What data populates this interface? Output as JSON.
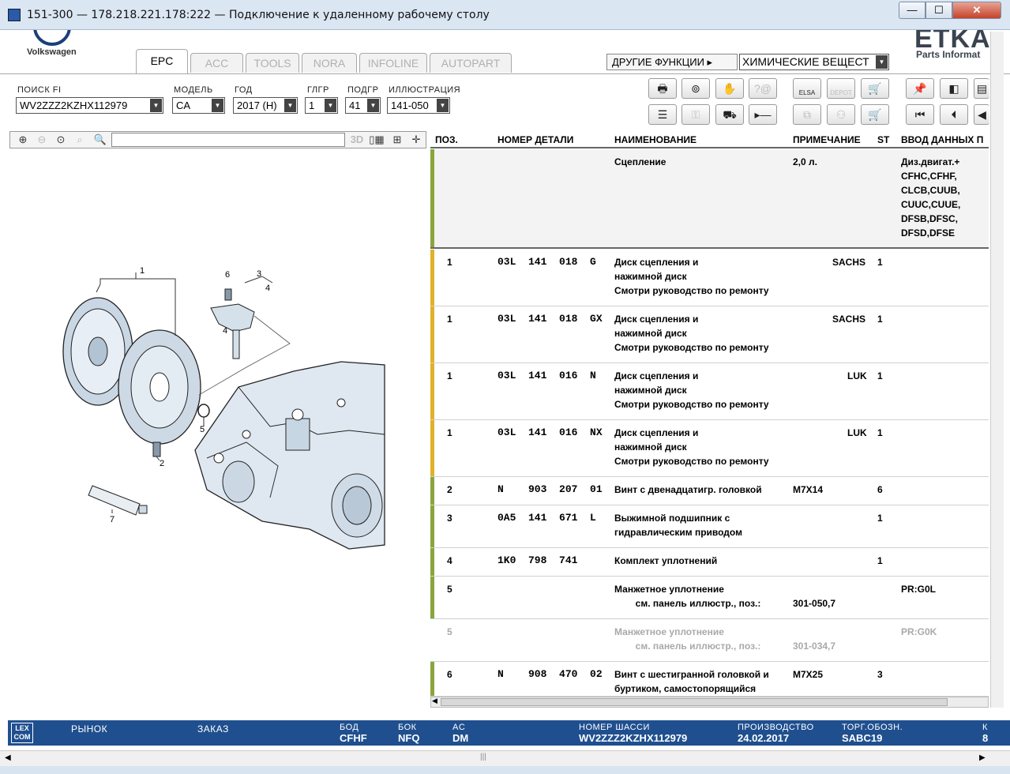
{
  "window": {
    "title": "151-300 — 178.218.221.178:222 — Подключение к удаленному рабочему столу",
    "min_label": "—",
    "max_label": "☐",
    "close_label": "✕"
  },
  "header": {
    "brand": "Volkswagen",
    "etka": "ETKA",
    "etka_sub": "Parts Informat",
    "tabs": [
      "EPC",
      "ACC",
      "TOOLS",
      "NORA",
      "INFOLINE",
      "AUTOPART"
    ],
    "other_functions": "ДРУГИЕ ФУНКЦИИ ▸",
    "chemicals": "ХИМИЧЕСКИЕ ВЕЩЕСТ"
  },
  "filters": {
    "search_label": "ПОИСК FI",
    "search_value": "WV2ZZZ2KZHX112979",
    "model_label": "МОДЕЛЬ",
    "model_value": "CA",
    "year_label": "ГОД",
    "year_value": "2017 (H)",
    "glgr_label": "ГЛГР",
    "glgr_value": "1",
    "podgr_label": "ПОДГР",
    "podgr_value": "41",
    "illus_label": "ИЛЛЮСТРАЦИЯ",
    "illus_value": "141-050"
  },
  "toolbar": {
    "elsa": "ELSA",
    "depot": "DEPOT"
  },
  "image_toolbar": {
    "btn_3d": "3D"
  },
  "table": {
    "headers": {
      "pos": "ПОЗ.",
      "part": "НОМЕР ДЕТАЛИ",
      "name": "НАИМЕНОВАНИЕ",
      "note": "ПРИМЕЧАНИЕ",
      "st": "ST",
      "input": "ВВОД ДАННЫХ П"
    },
    "rows": [
      {
        "pos": "",
        "part": "",
        "name": "Сцепление",
        "note": "2,0 л.",
        "st": "",
        "input": "Диз.двигат.+\nCFHC,CFHF,\nCLCB,CUUB,\nCUUC,CUUE,\nDFSB,DFSC,\nDFSD,DFSE"
      },
      {
        "pos": "1",
        "part": "03L  141  018  G",
        "name": "Диск сцепления и\nнажимной диск\nСмотри руководство по ремонту",
        "note": "SACHS",
        "st": "1",
        "input": ""
      },
      {
        "pos": "1",
        "part": "03L  141  018  GX",
        "name": "Диск сцепления и\nнажимной диск\nСмотри руководство по ремонту",
        "note": "SACHS",
        "st": "1",
        "input": ""
      },
      {
        "pos": "1",
        "part": "03L  141  016  N",
        "name": "Диск сцепления и\nнажимной диск\nСмотри руководство по ремонту",
        "note": "LUK",
        "st": "1",
        "input": ""
      },
      {
        "pos": "1",
        "part": "03L  141  016  NX",
        "name": "Диск сцепления и\nнажимной диск\nСмотри руководство по ремонту",
        "note": "LUK",
        "st": "1",
        "input": ""
      },
      {
        "pos": "2",
        "part": "N    903  207  01",
        "name": "Винт с двенадцатигр. головкой",
        "note": "M7X14",
        "st": "6",
        "input": ""
      },
      {
        "pos": "3",
        "part": "0A5  141  671  L",
        "name": "Выжимной подшипник с\nгидравлическим приводом",
        "note": "",
        "st": "1",
        "input": ""
      },
      {
        "pos": "4",
        "part": "1K0  798  741",
        "name": "Комплект уплотнений",
        "note": "",
        "st": "1",
        "input": ""
      },
      {
        "pos": "5",
        "part": "",
        "name": "Манжетное уплотнение\n        см. панель иллюстр., поз.:",
        "note": "\n301-050,7",
        "st": "",
        "input": "PR:G0L"
      },
      {
        "pos": "5",
        "part": "",
        "name": "Манжетное уплотнение\n        см. панель иллюстр., поз.:",
        "note": "\n301-034,7",
        "st": "",
        "input": "PR:G0K"
      },
      {
        "pos": "6",
        "part": "N    908  470  02",
        "name": "Винт с шестигранной головкой и\nбуртиком, самостопорящийся",
        "note": "M7X25",
        "st": "3",
        "input": ""
      }
    ]
  },
  "status": {
    "lexcom": "LEX\nCOM",
    "market_label": "РЫНОК",
    "order_label": "ЗАКАЗ",
    "bod_label": "БОД",
    "bod_value": "CFHF",
    "bok_label": "БОК",
    "bok_value": "NFQ",
    "ac_label": "AC",
    "ac_value": "DM",
    "chassis_label": "НОМЕР ШАССИ",
    "chassis_value": "WV2ZZZ2KZHX112979",
    "prod_label": "ПРОИЗВОДСТВО",
    "prod_value": "24.02.2017",
    "trade_label": "ТОРГ.ОБОЗН.",
    "trade_value": "SABC19",
    "k_label": "К",
    "k_value": "8"
  },
  "illustration": {
    "labels": [
      "1",
      "2",
      "3",
      "4",
      "4",
      "5",
      "6",
      "7"
    ]
  },
  "colors": {
    "bar_olive": "#8aa53c",
    "bar_gold": "#e0b22a",
    "bar_grey": "#c8c8c8",
    "status_blue": "#1f4f8f"
  }
}
